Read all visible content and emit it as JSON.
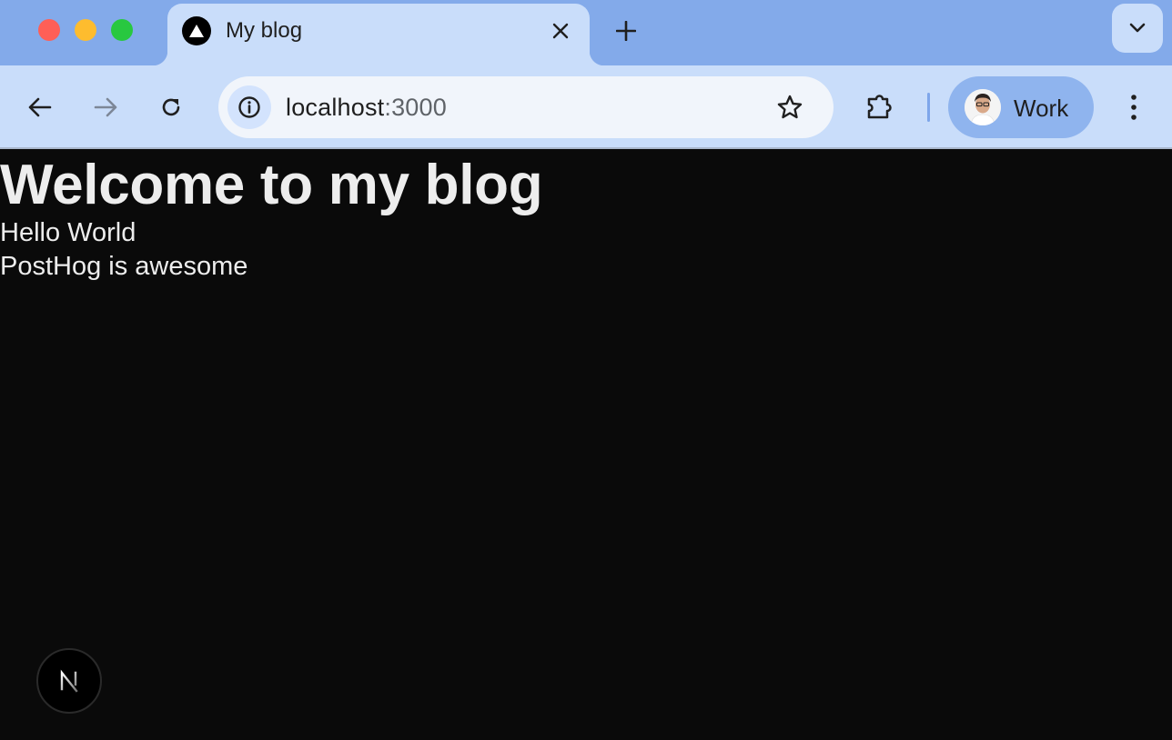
{
  "browser": {
    "tab": {
      "title": "My blog",
      "favicon": "vercel-triangle-icon"
    },
    "address": {
      "host": "localhost",
      "port": ":3000"
    },
    "profile": {
      "label": "Work"
    }
  },
  "page": {
    "heading": "Welcome to my blog",
    "posts": [
      "Hello World",
      "PostHog is awesome"
    ],
    "dev_badge": {
      "letter": "N"
    }
  },
  "colors": {
    "chrome_frame": "#83aaea",
    "chrome_toolbar": "#c9ddfa",
    "page_background": "#0a0a0a",
    "page_text": "#ededed"
  }
}
